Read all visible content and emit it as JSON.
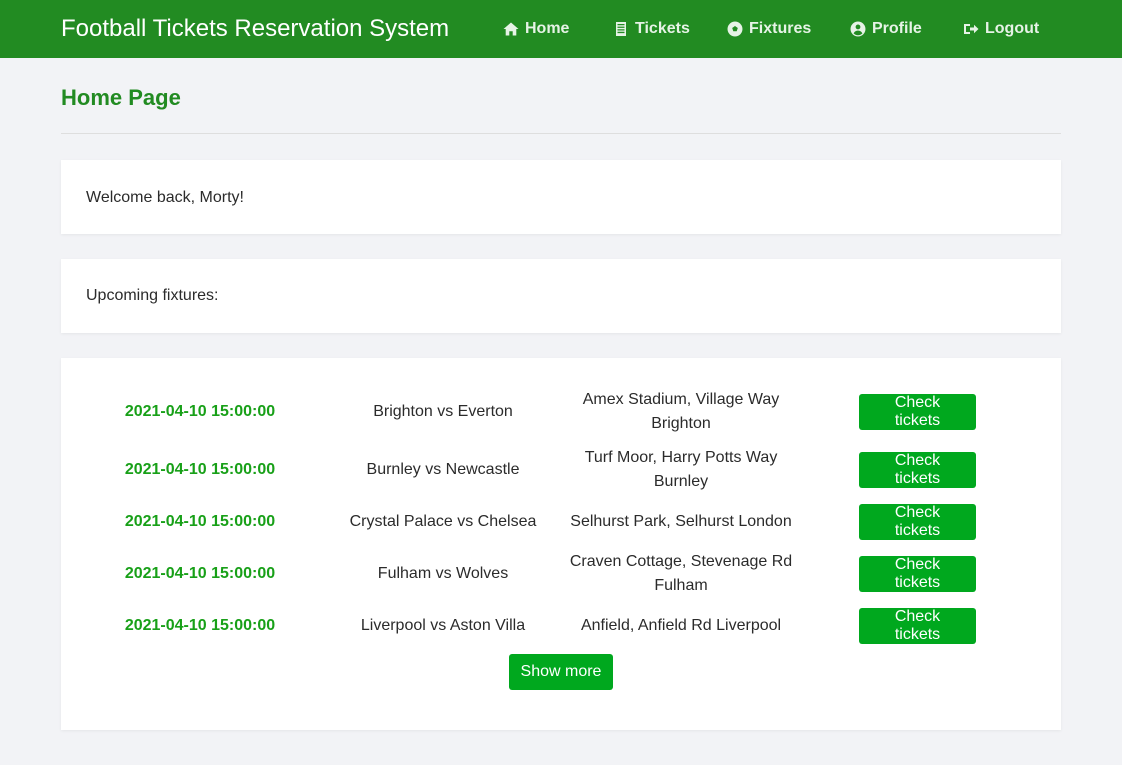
{
  "app": {
    "title": "Football Tickets Reservation System"
  },
  "nav": {
    "items": [
      {
        "label": "Home",
        "icon": "home-icon"
      },
      {
        "label": "Tickets",
        "icon": "ticket-icon"
      },
      {
        "label": "Fixtures",
        "icon": "football-icon"
      },
      {
        "label": "Profile",
        "icon": "user-circle-icon"
      },
      {
        "label": "Logout",
        "icon": "logout-icon"
      }
    ]
  },
  "page": {
    "title": "Home Page",
    "welcome": "Welcome back, Morty!",
    "upcoming_label": "Upcoming fixtures:"
  },
  "fixtures": [
    {
      "datetime": "2021-04-10 15:00:00",
      "match": "Brighton vs Everton",
      "venue_line1": "Amex Stadium, Village Way",
      "venue_line2": "Brighton",
      "button": "Check tickets"
    },
    {
      "datetime": "2021-04-10 15:00:00",
      "match": "Burnley vs Newcastle",
      "venue_line1": "Turf Moor, Harry Potts Way",
      "venue_line2": "Burnley",
      "button": "Check tickets"
    },
    {
      "datetime": "2021-04-10 15:00:00",
      "match": "Crystal Palace vs Chelsea",
      "venue_line1": "Selhurst Park, Selhurst London",
      "venue_line2": "",
      "button": "Check tickets"
    },
    {
      "datetime": "2021-04-10 15:00:00",
      "match": "Fulham vs Wolves",
      "venue_line1": "Craven Cottage, Stevenage Rd",
      "venue_line2": "Fulham",
      "button": "Check tickets"
    },
    {
      "datetime": "2021-04-10 15:00:00",
      "match": "Liverpool vs Aston Villa",
      "venue_line1": "Anfield, Anfield Rd Liverpool",
      "venue_line2": "",
      "button": "Check tickets"
    }
  ],
  "show_more_label": "Show more",
  "colors": {
    "navbar": "#228b22",
    "accent_text": "#228b22",
    "date_text": "#18a018",
    "button": "#00a81e",
    "background": "#f2f3f6"
  }
}
